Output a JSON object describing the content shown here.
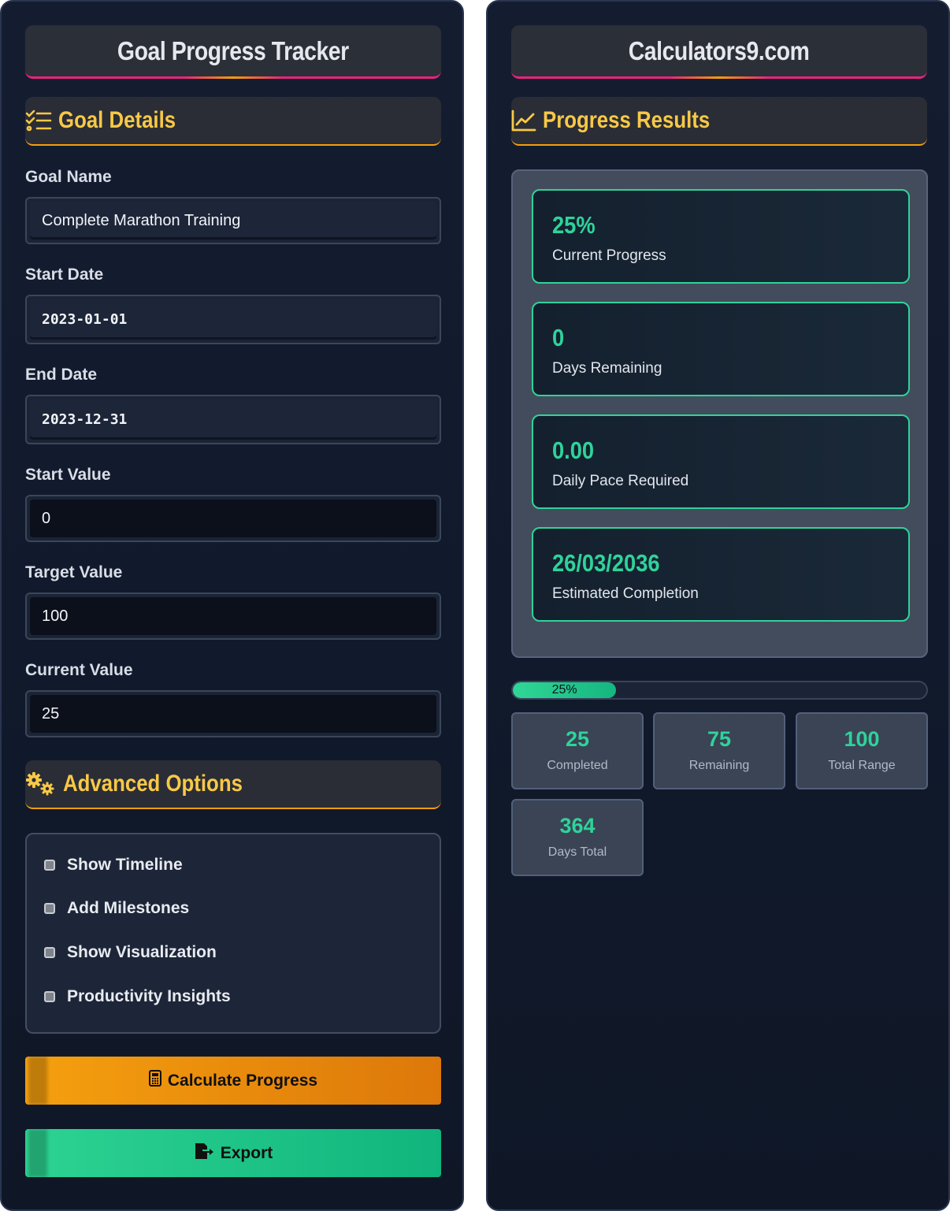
{
  "left": {
    "title": "Goal Progress Tracker",
    "goal_details_heading": "Goal Details",
    "fields": {
      "goal_name": {
        "label": "Goal Name",
        "value": "Complete Marathon Training"
      },
      "start_date": {
        "label": "Start Date",
        "value": "2023-01-01"
      },
      "end_date": {
        "label": "End Date",
        "value": "2023-12-31"
      },
      "start_value": {
        "label": "Start Value",
        "value": "0"
      },
      "target_value": {
        "label": "Target Value",
        "value": "100"
      },
      "current_value": {
        "label": "Current Value",
        "value": "25"
      }
    },
    "advanced_heading": "Advanced Options",
    "options": [
      {
        "label": "Show Timeline"
      },
      {
        "label": "Add Milestones"
      },
      {
        "label": "Show Visualization"
      },
      {
        "label": "Productivity Insights"
      }
    ],
    "buttons": {
      "calculate": "Calculate Progress",
      "export": "Export"
    }
  },
  "right": {
    "title": "Calculators9.com",
    "results_heading": "Progress Results",
    "cards": [
      {
        "value": "25%",
        "label": "Current Progress"
      },
      {
        "value": "0",
        "label": "Days Remaining"
      },
      {
        "value": "0.00",
        "label": "Daily Pace Required"
      },
      {
        "value": "26/03/2036",
        "label": "Estimated Completion"
      }
    ],
    "progress": {
      "percent": 25,
      "label": "25%"
    },
    "stats": [
      {
        "value": "25",
        "label": "Completed"
      },
      {
        "value": "75",
        "label": "Remaining"
      },
      {
        "value": "100",
        "label": "Total Range"
      },
      {
        "value": "364",
        "label": "Days Total"
      }
    ]
  },
  "colors": {
    "accent_yellow": "#f8c847",
    "accent_green": "#2fd39a",
    "accent_pink": "#e8237a",
    "accent_orange": "#f59e0b"
  },
  "icons": [
    "list-check-icon",
    "chart-line-icon",
    "gears-icon",
    "calculator-icon",
    "file-export-icon"
  ]
}
